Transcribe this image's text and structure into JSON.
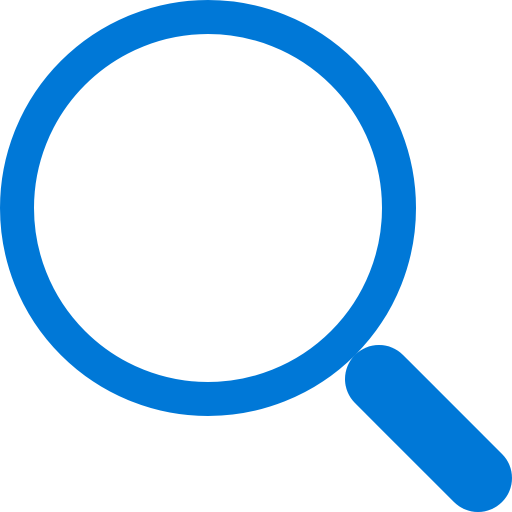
{
  "icon": {
    "name": "search-icon",
    "color": "#0078D7",
    "background": "#FFFFFF"
  }
}
